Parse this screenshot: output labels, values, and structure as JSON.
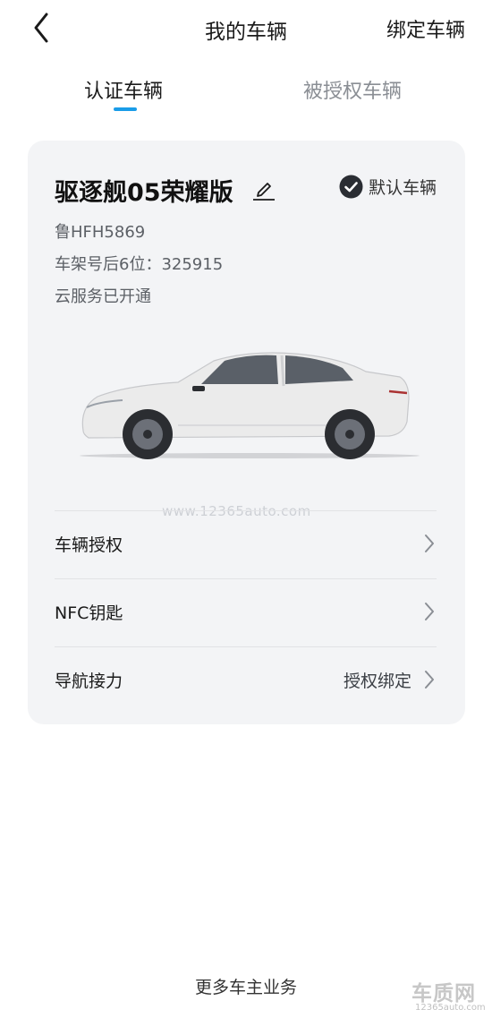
{
  "header": {
    "title": "我的车辆",
    "bind_label": "绑定车辆"
  },
  "tabs": [
    {
      "label": "认证车辆",
      "active": true
    },
    {
      "label": "被授权车辆",
      "active": false
    }
  ],
  "vehicle": {
    "name": "驱逐舰05荣耀版",
    "default_label": "默认车辆",
    "plate": "鲁HFH5869",
    "vin_tail": "车架号后6位：325915",
    "cloud_status": "云服务已开通",
    "color": "#ebebeb"
  },
  "menu": [
    {
      "label": "车辆授权",
      "value": ""
    },
    {
      "label": "NFC钥匙",
      "value": ""
    },
    {
      "label": "导航接力",
      "value": "授权绑定"
    }
  ],
  "footer": {
    "more_label": "更多车主业务"
  },
  "watermark": {
    "text": "www.12365auto.com",
    "logo_text": "车质网",
    "logo_sub": "12365auto.com"
  },
  "colors": {
    "accent": "#1a9ce8",
    "card_bg": "#f3f4f6",
    "muted": "#8a8e94"
  }
}
